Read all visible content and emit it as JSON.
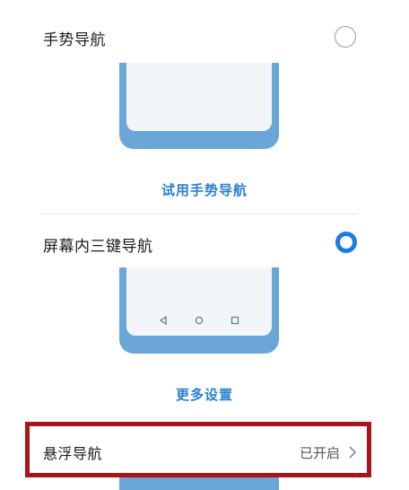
{
  "options": [
    {
      "title": "手势导航",
      "selected": false,
      "action": "试用手势导航"
    },
    {
      "title": "屏幕内三键导航",
      "selected": true,
      "action": "更多设置"
    }
  ],
  "floating_nav": {
    "title": "悬浮导航",
    "status": "已开启"
  },
  "icons": {
    "radio_off": "radio-unchecked-icon",
    "radio_on": "radio-checked-icon",
    "back": "back-triangle-icon",
    "home": "home-circle-icon",
    "recent": "recent-square-icon",
    "chevron": "chevron-right-icon"
  },
  "colors": {
    "accent": "#1e7be0",
    "link": "#2b7fd4",
    "phone_frame": "#6aa6d8",
    "highlight": "#a8161b"
  }
}
